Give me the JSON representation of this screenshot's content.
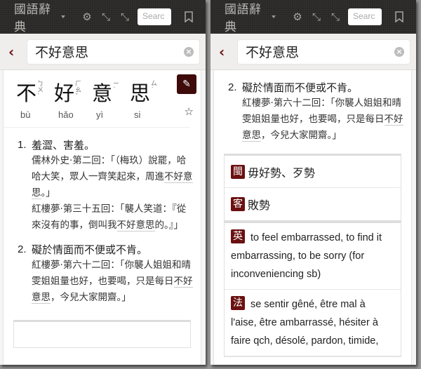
{
  "app": {
    "brand": "國語辭典",
    "search_placeholder": "Search",
    "search_visible": "Searc",
    "icons": [
      "gears-icon",
      "compress-icon",
      "compress-icon",
      "bookmark-icon"
    ]
  },
  "query": "不好意思",
  "heading": {
    "characters": [
      {
        "hanzi": "不",
        "bopomofo": "ㄅㄨˋ",
        "pinyin": "bù"
      },
      {
        "hanzi": "好",
        "bopomofo": "ㄏㄠˇ",
        "pinyin": "hǎo"
      },
      {
        "hanzi": "意",
        "bopomofo": "ㄧˋ",
        "pinyin": "yì"
      },
      {
        "hanzi": "思",
        "bopomofo": "ㄙ˙",
        "pinyin": "si"
      }
    ]
  },
  "definitions": [
    {
      "num": "1.",
      "text": "羞澀、害羞。",
      "examples": [
        {
          "pre": "儒林外史·第二回：「（梅玖）說罷，哈哈大笑，眾人一齊笑起來，周進",
          "hl": "不好意思",
          "post": "。」"
        },
        {
          "pre": "紅樓夢·第三十五回：「襲人笑道：『從來沒有的事，倒叫我",
          "hl": "不好意思",
          "post": "的。』」"
        }
      ]
    },
    {
      "num": "2.",
      "text": "礙於情面而不便或不肯。",
      "examples": [
        {
          "pre": "紅樓夢·第六十二回：「你襲人姐姐和晴雯姐姐量也好，也要喝，只是每日",
          "hl": "不好意思",
          "post": "，今兒大家開齋。」"
        }
      ]
    }
  ],
  "cross_refs": [
    {
      "badge": "閩",
      "text": "毋好勢、歹勢"
    },
    {
      "badge": "客",
      "text": "敗勢"
    }
  ],
  "translations": [
    {
      "badge": "英",
      "text": "to feel embarrassed, to find it embarrassing, to be sorry (for inconveniencing sb)"
    },
    {
      "badge": "法",
      "text": "se sentir gêné, être mal à l'aise, être ambarrassé, hésiter à faire qch, désolé, pardon, timide,"
    }
  ],
  "colors": {
    "accent": "#6a1010",
    "navbar": "#2a2827",
    "edit_button": "#3e0a0a"
  }
}
